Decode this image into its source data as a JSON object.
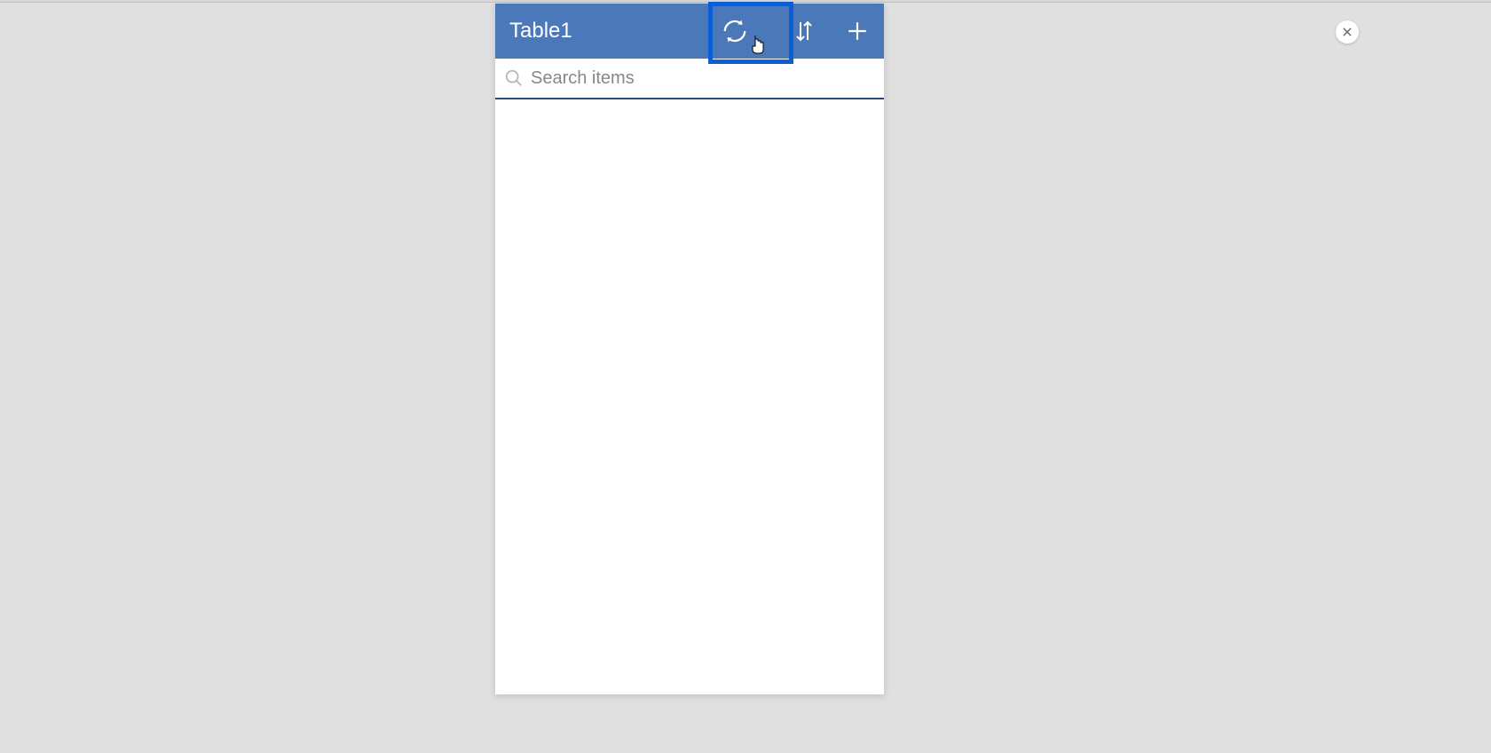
{
  "panel": {
    "title": "Table1",
    "search": {
      "placeholder": "Search items",
      "value": ""
    },
    "actions": {
      "refresh": "refresh",
      "sort": "sort",
      "add": "add"
    }
  },
  "close": {
    "label": "close"
  },
  "colors": {
    "header_bg": "#4a78b8",
    "highlight": "#0a5fd6",
    "page_bg": "#e0e0e0"
  }
}
